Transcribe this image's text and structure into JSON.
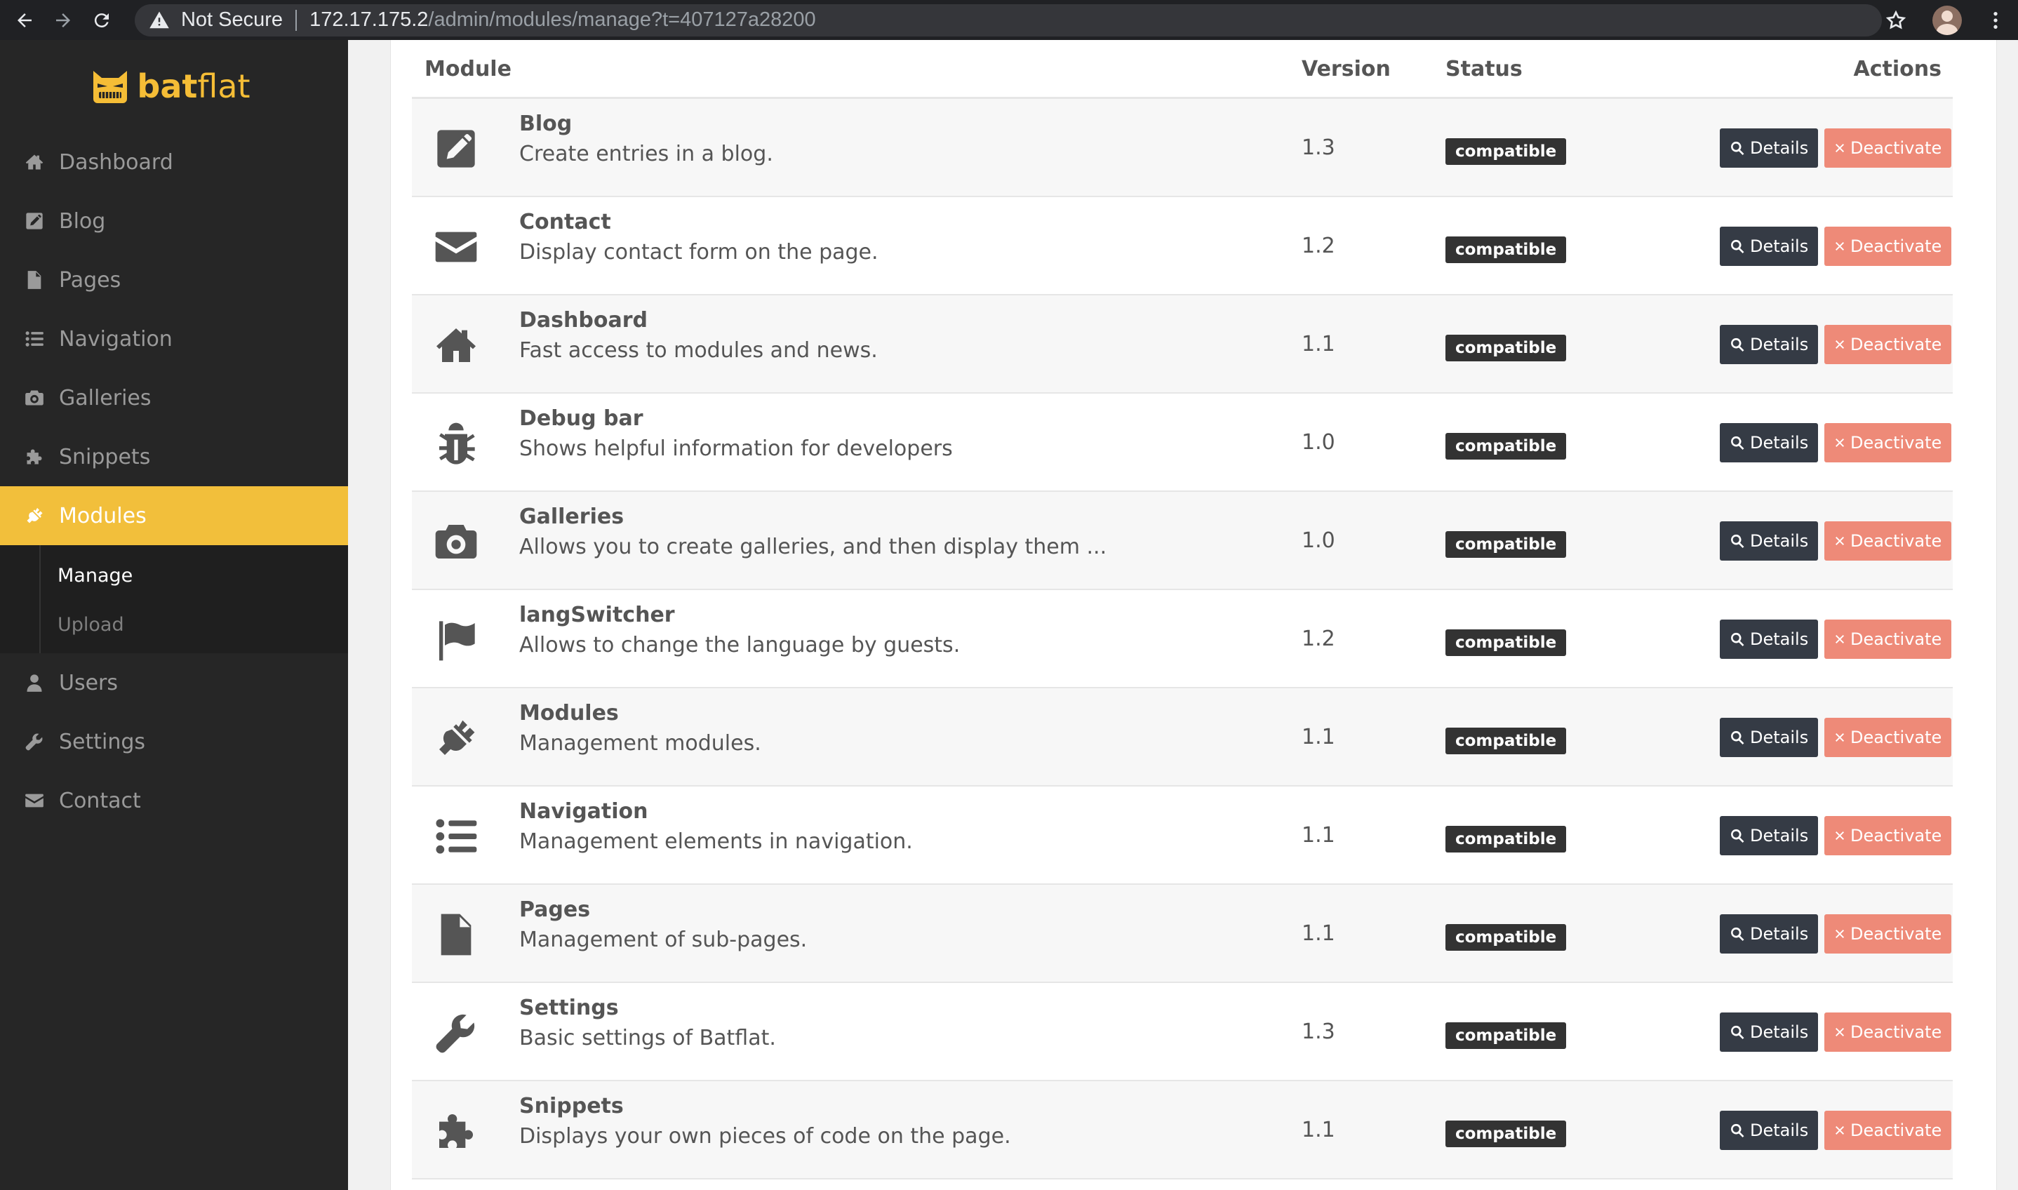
{
  "browser": {
    "security_label": "Not Secure",
    "url_host": "172.17.175.2",
    "url_path": "/admin/modules/manage?t=407127a28200"
  },
  "brand": {
    "name_bold": "bat",
    "name_rest": "flat",
    "color": "#f5bd36"
  },
  "sidebar": {
    "items": [
      {
        "label": "Dashboard",
        "icon": "home-icon"
      },
      {
        "label": "Blog",
        "icon": "edit-icon"
      },
      {
        "label": "Pages",
        "icon": "file-icon"
      },
      {
        "label": "Navigation",
        "icon": "list-icon"
      },
      {
        "label": "Galleries",
        "icon": "camera-icon"
      },
      {
        "label": "Snippets",
        "icon": "puzzle-icon"
      },
      {
        "label": "Modules",
        "icon": "plug-icon",
        "active": true
      },
      {
        "label": "Users",
        "icon": "user-icon"
      },
      {
        "label": "Settings",
        "icon": "wrench-icon"
      },
      {
        "label": "Contact",
        "icon": "envelope-icon"
      }
    ],
    "submenu": [
      {
        "label": "Manage",
        "current": true
      },
      {
        "label": "Upload",
        "current": false
      }
    ],
    "active_color": "#f2bf3b"
  },
  "table": {
    "headers": {
      "module": "Module",
      "version": "Version",
      "status": "Status",
      "actions": "Actions"
    },
    "details_label": "Details",
    "deactivate_label": "Deactivate",
    "rows": [
      {
        "title": "Blog",
        "desc": "Create entries in a blog.",
        "version": "1.3",
        "status": "compatible",
        "icon": "edit-icon"
      },
      {
        "title": "Contact",
        "desc": "Display contact form on the page.",
        "version": "1.2",
        "status": "compatible",
        "icon": "envelope-icon"
      },
      {
        "title": "Dashboard",
        "desc": "Fast access to modules and news.",
        "version": "1.1",
        "status": "compatible",
        "icon": "home-icon"
      },
      {
        "title": "Debug bar",
        "desc": "Shows helpful information for developers",
        "version": "1.0",
        "status": "compatible",
        "icon": "bug-icon"
      },
      {
        "title": "Galleries",
        "desc": "Allows you to create galleries, and then display them ...",
        "version": "1.0",
        "status": "compatible",
        "icon": "camera-icon"
      },
      {
        "title": "langSwitcher",
        "desc": "Allows to change the language by guests.",
        "version": "1.2",
        "status": "compatible",
        "icon": "flag-icon"
      },
      {
        "title": "Modules",
        "desc": "Management modules.",
        "version": "1.1",
        "status": "compatible",
        "icon": "plug-icon"
      },
      {
        "title": "Navigation",
        "desc": "Management elements in navigation.",
        "version": "1.1",
        "status": "compatible",
        "icon": "list-icon"
      },
      {
        "title": "Pages",
        "desc": "Management of sub-pages.",
        "version": "1.1",
        "status": "compatible",
        "icon": "file-icon"
      },
      {
        "title": "Settings",
        "desc": "Basic settings of Batflat.",
        "version": "1.3",
        "status": "compatible",
        "icon": "wrench-icon"
      },
      {
        "title": "Snippets",
        "desc": "Displays your own pieces of code on the page.",
        "version": "1.1",
        "status": "compatible",
        "icon": "puzzle-icon"
      }
    ]
  }
}
